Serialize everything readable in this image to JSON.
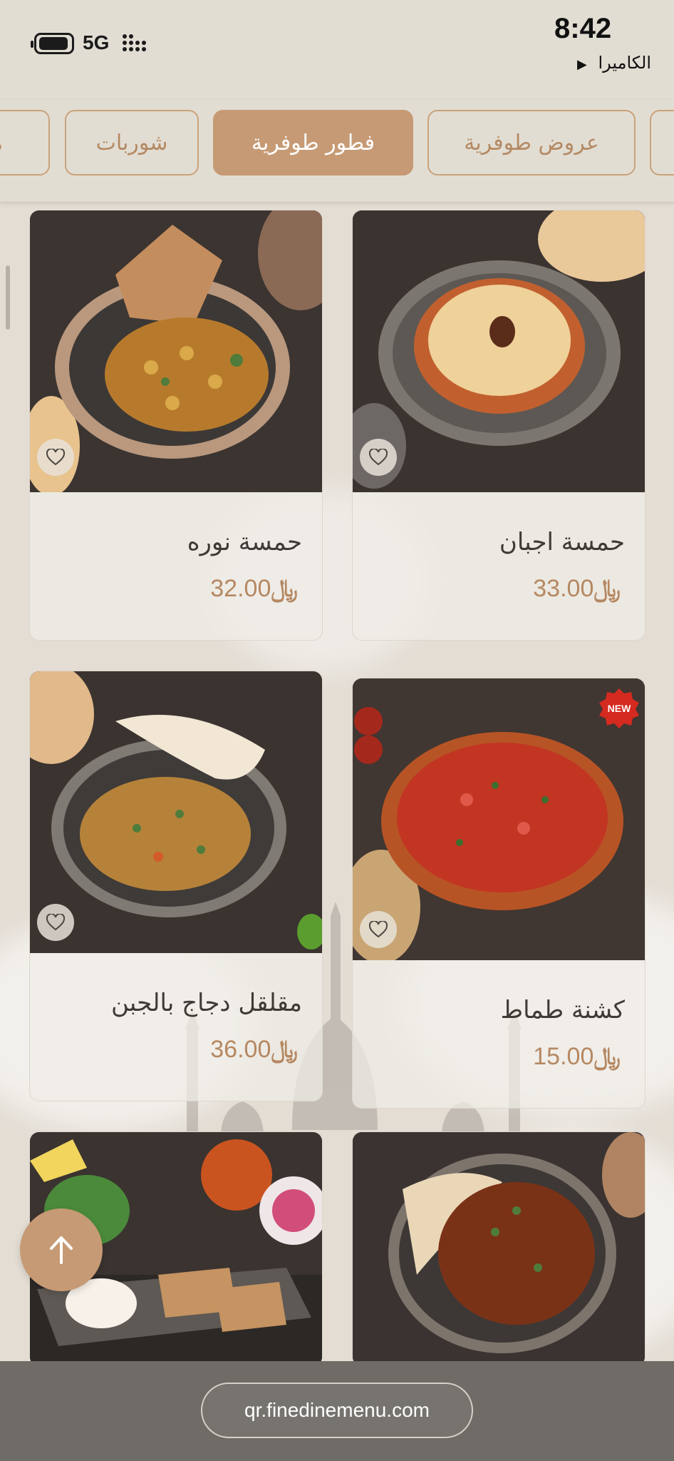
{
  "status_bar": {
    "network": "5G",
    "time": "8:42",
    "camera_label": "الكاميرا"
  },
  "tabs": [
    {
      "label": "عروض طوفرية",
      "active": false
    },
    {
      "label": "فطور طوفرية",
      "active": true
    },
    {
      "label": "شوربات",
      "active": false
    },
    {
      "label": "مع",
      "active": false
    }
  ],
  "currency_symbol": "﷼",
  "menu_items": [
    {
      "name": "حمسة اجبان",
      "price": "33.00",
      "is_new": false
    },
    {
      "name": "حمسة نوره",
      "price": "32.00",
      "is_new": false
    },
    {
      "name": "كشنة طماط",
      "price": "15.00",
      "is_new": true
    },
    {
      "name": "مقلقل دجاج بالجبن",
      "price": "36.00",
      "is_new": false
    }
  ],
  "new_badge_label": "NEW",
  "url": "qr.finedinemenu.com",
  "colors": {
    "accent": "#c69a74",
    "background": "#e3ddd4",
    "price": "#b58862",
    "url_bar": "#6f6b66"
  },
  "icons": [
    "battery-icon",
    "signal-icon",
    "heart-icon",
    "arrow-up-icon",
    "new-badge-icon"
  ]
}
